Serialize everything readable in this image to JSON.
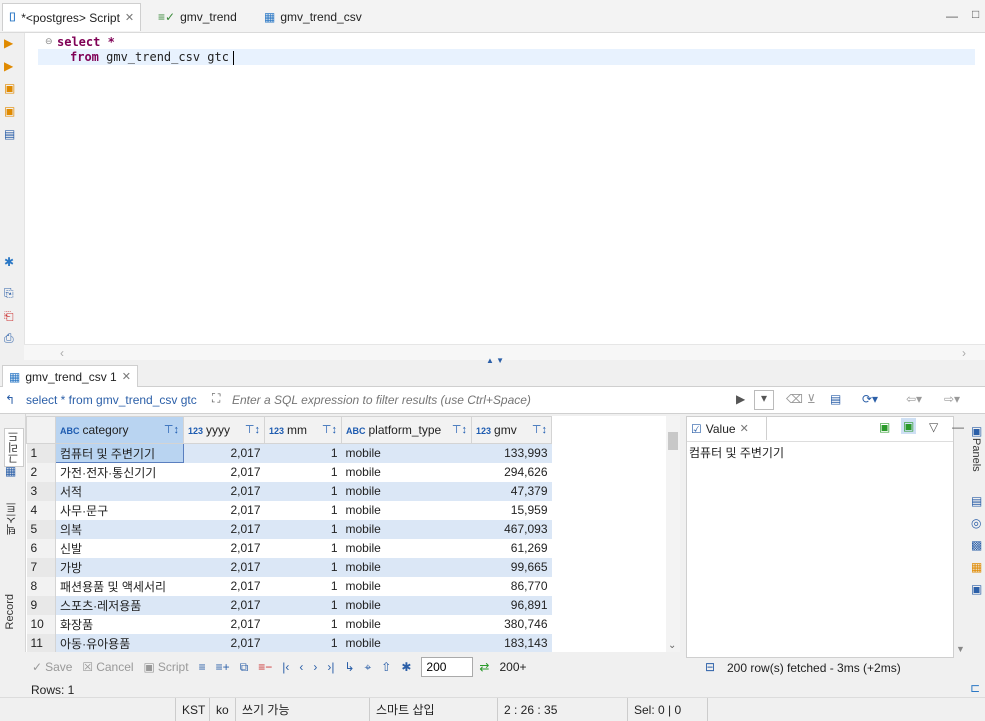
{
  "editor_tabs": [
    {
      "label": "*<postgres> Script",
      "active": true
    },
    {
      "label": "gmv_trend",
      "active": false
    },
    {
      "label": "gmv_trend_csv",
      "active": false
    }
  ],
  "sql": {
    "line1": "select *",
    "line2_kw": "from",
    "line2_rest": " gmv_trend_csv gtc"
  },
  "sql_keywords": {
    "select": "select"
  },
  "results_tab": "gmv_trend_csv 1",
  "filter": {
    "query": "select * from gmv_trend_csv gtc",
    "placeholder": "Enter a SQL expression to filter results (use Ctrl+Space)"
  },
  "columns": [
    {
      "type": "ABC",
      "name": "category"
    },
    {
      "type": "123",
      "name": "yyyy"
    },
    {
      "type": "123",
      "name": "mm"
    },
    {
      "type": "ABC",
      "name": "platform_type"
    },
    {
      "type": "123",
      "name": "gmv"
    }
  ],
  "rows": [
    {
      "n": "1",
      "category": "컴퓨터 및 주변기기",
      "yyyy": "2,017",
      "mm": "1",
      "platform": "mobile",
      "gmv": "133,993"
    },
    {
      "n": "2",
      "category": "가전·전자·통신기기",
      "yyyy": "2,017",
      "mm": "1",
      "platform": "mobile",
      "gmv": "294,626"
    },
    {
      "n": "3",
      "category": "서적",
      "yyyy": "2,017",
      "mm": "1",
      "platform": "mobile",
      "gmv": "47,379"
    },
    {
      "n": "4",
      "category": "사무·문구",
      "yyyy": "2,017",
      "mm": "1",
      "platform": "mobile",
      "gmv": "15,959"
    },
    {
      "n": "5",
      "category": "의복",
      "yyyy": "2,017",
      "mm": "1",
      "platform": "mobile",
      "gmv": "467,093"
    },
    {
      "n": "6",
      "category": "신발",
      "yyyy": "2,017",
      "mm": "1",
      "platform": "mobile",
      "gmv": "61,269"
    },
    {
      "n": "7",
      "category": "가방",
      "yyyy": "2,017",
      "mm": "1",
      "platform": "mobile",
      "gmv": "99,665"
    },
    {
      "n": "8",
      "category": "패션용품 및 액세서리",
      "yyyy": "2,017",
      "mm": "1",
      "platform": "mobile",
      "gmv": "86,770"
    },
    {
      "n": "9",
      "category": "스포츠·레저용품",
      "yyyy": "2,017",
      "mm": "1",
      "platform": "mobile",
      "gmv": "96,891"
    },
    {
      "n": "10",
      "category": "화장품",
      "yyyy": "2,017",
      "mm": "1",
      "platform": "mobile",
      "gmv": "380,746"
    },
    {
      "n": "11",
      "category": "아동·유아용품",
      "yyyy": "2,017",
      "mm": "1",
      "platform": "mobile",
      "gmv": "183,143"
    }
  ],
  "value_panel": {
    "title": "Value",
    "content": "컴퓨터 및 주변기기"
  },
  "side_labels": {
    "grid": "그리드",
    "text": "텍스트",
    "record": "Record",
    "panels": "Panels"
  },
  "toolbar": {
    "save": "Save",
    "cancel": "Cancel",
    "script": "Script",
    "fetch_size": "200",
    "fetch_more": "200+",
    "fetched": "200 row(s) fetched - 3ms (+2ms)"
  },
  "rows_count": "Rows: 1",
  "status": {
    "tz": "KST",
    "locale": "ko",
    "mode": "쓰기 가능",
    "insert": "스마트 삽입",
    "pos": "2 : 26 : 35",
    "sel": "Sel: 0 | 0"
  },
  "colors": {
    "selected": "#b9d4f1",
    "stripe": "#dbe7f6",
    "keyword": "#7f0055"
  }
}
